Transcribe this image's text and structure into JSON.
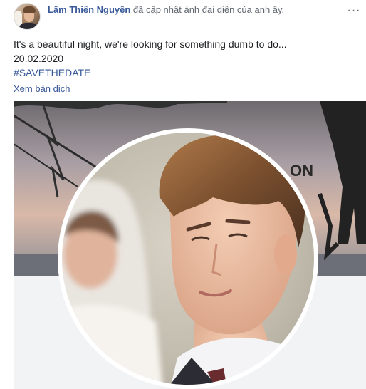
{
  "post": {
    "author": "Lâm Thiên Nguyện",
    "action": " đã cập nhật ảnh đại diện của anh ấy.",
    "more_label": "···",
    "text_lines": [
      "It's a beautiful night, we're looking for something dumb to do...",
      "20.02.2020"
    ],
    "hashtag": "#SAVETHEDATE",
    "translate_link": "Xem bản dịch",
    "cover_text": "ON"
  },
  "icons": {
    "more": "more-options-icon",
    "avatar": "profile-avatar"
  }
}
